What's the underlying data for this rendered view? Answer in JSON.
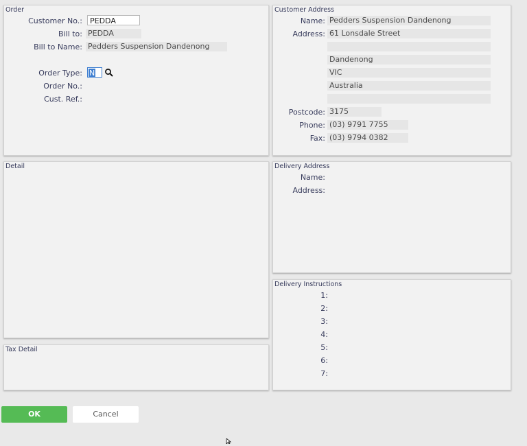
{
  "order": {
    "title": "Order",
    "customer_no_label": "Customer No.:",
    "customer_no_value": "PEDDA",
    "bill_to_label": "Bill to:",
    "bill_to_value": "PEDDA",
    "bill_to_name_label": "Bill to Name:",
    "bill_to_name_value": "Pedders Suspension Dandenong",
    "order_type_label": "Order Type:",
    "order_type_value": "N",
    "order_no_label": "Order No.:",
    "cust_ref_label": "Cust. Ref.:"
  },
  "customer_address": {
    "title": "Customer Address",
    "name_label": "Name:",
    "name_value": "Pedders Suspension Dandenong",
    "address_label": "Address:",
    "address_lines": [
      "61 Lonsdale Street",
      "",
      "Dandenong",
      "VIC",
      "Australia",
      ""
    ],
    "postcode_label": "Postcode:",
    "postcode_value": "3175",
    "phone_label": "Phone:",
    "phone_value": "(03) 9791 7755",
    "fax_label": "Fax:",
    "fax_value": "(03) 9794 0382"
  },
  "detail": {
    "title": "Detail"
  },
  "delivery_address": {
    "title": "Delivery Address",
    "name_label": "Name:",
    "address_label": "Address:"
  },
  "delivery_instructions": {
    "title": "Delivery Instructions",
    "lines": [
      "1:",
      "2:",
      "3:",
      "4:",
      "5:",
      "6:",
      "7:"
    ]
  },
  "tax_detail": {
    "title": "Tax Detail"
  },
  "actions": {
    "ok_label": "OK",
    "cancel_label": "Cancel"
  },
  "colors": {
    "ok": "#55bb55",
    "label": "#35395a",
    "selection": "#3f7fd1"
  },
  "icons": {
    "lookup": "search-icon",
    "cursor": "mouse-cursor-icon"
  }
}
